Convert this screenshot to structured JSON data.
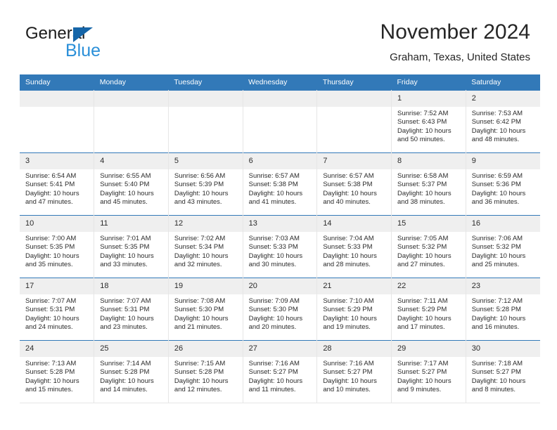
{
  "brand": {
    "line1": "General",
    "line2": "Blue",
    "triangle_color": "#1565a8",
    "blue_text_color": "#2a8fd8"
  },
  "header": {
    "title": "November 2024",
    "subtitle": "Graham, Texas, United States",
    "accent_color": "#3279b8",
    "daynum_band_color": "#efefef"
  },
  "weekday_headers": [
    "Sunday",
    "Monday",
    "Tuesday",
    "Wednesday",
    "Thursday",
    "Friday",
    "Saturday"
  ],
  "labels": {
    "sunrise_prefix": "Sunrise:",
    "sunset_prefix": "Sunset:",
    "daylight_prefix": "Daylight:"
  },
  "weeks": [
    [
      {
        "day": "",
        "sunrise": "",
        "sunset": "",
        "daylight_line1": "",
        "daylight_line2": ""
      },
      {
        "day": "",
        "sunrise": "",
        "sunset": "",
        "daylight_line1": "",
        "daylight_line2": ""
      },
      {
        "day": "",
        "sunrise": "",
        "sunset": "",
        "daylight_line1": "",
        "daylight_line2": ""
      },
      {
        "day": "",
        "sunrise": "",
        "sunset": "",
        "daylight_line1": "",
        "daylight_line2": ""
      },
      {
        "day": "",
        "sunrise": "",
        "sunset": "",
        "daylight_line1": "",
        "daylight_line2": ""
      },
      {
        "day": "1",
        "sunrise": "Sunrise: 7:52 AM",
        "sunset": "Sunset: 6:43 PM",
        "daylight_line1": "Daylight: 10 hours",
        "daylight_line2": "and 50 minutes."
      },
      {
        "day": "2",
        "sunrise": "Sunrise: 7:53 AM",
        "sunset": "Sunset: 6:42 PM",
        "daylight_line1": "Daylight: 10 hours",
        "daylight_line2": "and 48 minutes."
      }
    ],
    [
      {
        "day": "3",
        "sunrise": "Sunrise: 6:54 AM",
        "sunset": "Sunset: 5:41 PM",
        "daylight_line1": "Daylight: 10 hours",
        "daylight_line2": "and 47 minutes."
      },
      {
        "day": "4",
        "sunrise": "Sunrise: 6:55 AM",
        "sunset": "Sunset: 5:40 PM",
        "daylight_line1": "Daylight: 10 hours",
        "daylight_line2": "and 45 minutes."
      },
      {
        "day": "5",
        "sunrise": "Sunrise: 6:56 AM",
        "sunset": "Sunset: 5:39 PM",
        "daylight_line1": "Daylight: 10 hours",
        "daylight_line2": "and 43 minutes."
      },
      {
        "day": "6",
        "sunrise": "Sunrise: 6:57 AM",
        "sunset": "Sunset: 5:38 PM",
        "daylight_line1": "Daylight: 10 hours",
        "daylight_line2": "and 41 minutes."
      },
      {
        "day": "7",
        "sunrise": "Sunrise: 6:57 AM",
        "sunset": "Sunset: 5:38 PM",
        "daylight_line1": "Daylight: 10 hours",
        "daylight_line2": "and 40 minutes."
      },
      {
        "day": "8",
        "sunrise": "Sunrise: 6:58 AM",
        "sunset": "Sunset: 5:37 PM",
        "daylight_line1": "Daylight: 10 hours",
        "daylight_line2": "and 38 minutes."
      },
      {
        "day": "9",
        "sunrise": "Sunrise: 6:59 AM",
        "sunset": "Sunset: 5:36 PM",
        "daylight_line1": "Daylight: 10 hours",
        "daylight_line2": "and 36 minutes."
      }
    ],
    [
      {
        "day": "10",
        "sunrise": "Sunrise: 7:00 AM",
        "sunset": "Sunset: 5:35 PM",
        "daylight_line1": "Daylight: 10 hours",
        "daylight_line2": "and 35 minutes."
      },
      {
        "day": "11",
        "sunrise": "Sunrise: 7:01 AM",
        "sunset": "Sunset: 5:35 PM",
        "daylight_line1": "Daylight: 10 hours",
        "daylight_line2": "and 33 minutes."
      },
      {
        "day": "12",
        "sunrise": "Sunrise: 7:02 AM",
        "sunset": "Sunset: 5:34 PM",
        "daylight_line1": "Daylight: 10 hours",
        "daylight_line2": "and 32 minutes."
      },
      {
        "day": "13",
        "sunrise": "Sunrise: 7:03 AM",
        "sunset": "Sunset: 5:33 PM",
        "daylight_line1": "Daylight: 10 hours",
        "daylight_line2": "and 30 minutes."
      },
      {
        "day": "14",
        "sunrise": "Sunrise: 7:04 AM",
        "sunset": "Sunset: 5:33 PM",
        "daylight_line1": "Daylight: 10 hours",
        "daylight_line2": "and 28 minutes."
      },
      {
        "day": "15",
        "sunrise": "Sunrise: 7:05 AM",
        "sunset": "Sunset: 5:32 PM",
        "daylight_line1": "Daylight: 10 hours",
        "daylight_line2": "and 27 minutes."
      },
      {
        "day": "16",
        "sunrise": "Sunrise: 7:06 AM",
        "sunset": "Sunset: 5:32 PM",
        "daylight_line1": "Daylight: 10 hours",
        "daylight_line2": "and 25 minutes."
      }
    ],
    [
      {
        "day": "17",
        "sunrise": "Sunrise: 7:07 AM",
        "sunset": "Sunset: 5:31 PM",
        "daylight_line1": "Daylight: 10 hours",
        "daylight_line2": "and 24 minutes."
      },
      {
        "day": "18",
        "sunrise": "Sunrise: 7:07 AM",
        "sunset": "Sunset: 5:31 PM",
        "daylight_line1": "Daylight: 10 hours",
        "daylight_line2": "and 23 minutes."
      },
      {
        "day": "19",
        "sunrise": "Sunrise: 7:08 AM",
        "sunset": "Sunset: 5:30 PM",
        "daylight_line1": "Daylight: 10 hours",
        "daylight_line2": "and 21 minutes."
      },
      {
        "day": "20",
        "sunrise": "Sunrise: 7:09 AM",
        "sunset": "Sunset: 5:30 PM",
        "daylight_line1": "Daylight: 10 hours",
        "daylight_line2": "and 20 minutes."
      },
      {
        "day": "21",
        "sunrise": "Sunrise: 7:10 AM",
        "sunset": "Sunset: 5:29 PM",
        "daylight_line1": "Daylight: 10 hours",
        "daylight_line2": "and 19 minutes."
      },
      {
        "day": "22",
        "sunrise": "Sunrise: 7:11 AM",
        "sunset": "Sunset: 5:29 PM",
        "daylight_line1": "Daylight: 10 hours",
        "daylight_line2": "and 17 minutes."
      },
      {
        "day": "23",
        "sunrise": "Sunrise: 7:12 AM",
        "sunset": "Sunset: 5:28 PM",
        "daylight_line1": "Daylight: 10 hours",
        "daylight_line2": "and 16 minutes."
      }
    ],
    [
      {
        "day": "24",
        "sunrise": "Sunrise: 7:13 AM",
        "sunset": "Sunset: 5:28 PM",
        "daylight_line1": "Daylight: 10 hours",
        "daylight_line2": "and 15 minutes."
      },
      {
        "day": "25",
        "sunrise": "Sunrise: 7:14 AM",
        "sunset": "Sunset: 5:28 PM",
        "daylight_line1": "Daylight: 10 hours",
        "daylight_line2": "and 14 minutes."
      },
      {
        "day": "26",
        "sunrise": "Sunrise: 7:15 AM",
        "sunset": "Sunset: 5:28 PM",
        "daylight_line1": "Daylight: 10 hours",
        "daylight_line2": "and 12 minutes."
      },
      {
        "day": "27",
        "sunrise": "Sunrise: 7:16 AM",
        "sunset": "Sunset: 5:27 PM",
        "daylight_line1": "Daylight: 10 hours",
        "daylight_line2": "and 11 minutes."
      },
      {
        "day": "28",
        "sunrise": "Sunrise: 7:16 AM",
        "sunset": "Sunset: 5:27 PM",
        "daylight_line1": "Daylight: 10 hours",
        "daylight_line2": "and 10 minutes."
      },
      {
        "day": "29",
        "sunrise": "Sunrise: 7:17 AM",
        "sunset": "Sunset: 5:27 PM",
        "daylight_line1": "Daylight: 10 hours",
        "daylight_line2": "and 9 minutes."
      },
      {
        "day": "30",
        "sunrise": "Sunrise: 7:18 AM",
        "sunset": "Sunset: 5:27 PM",
        "daylight_line1": "Daylight: 10 hours",
        "daylight_line2": "and 8 minutes."
      }
    ]
  ]
}
